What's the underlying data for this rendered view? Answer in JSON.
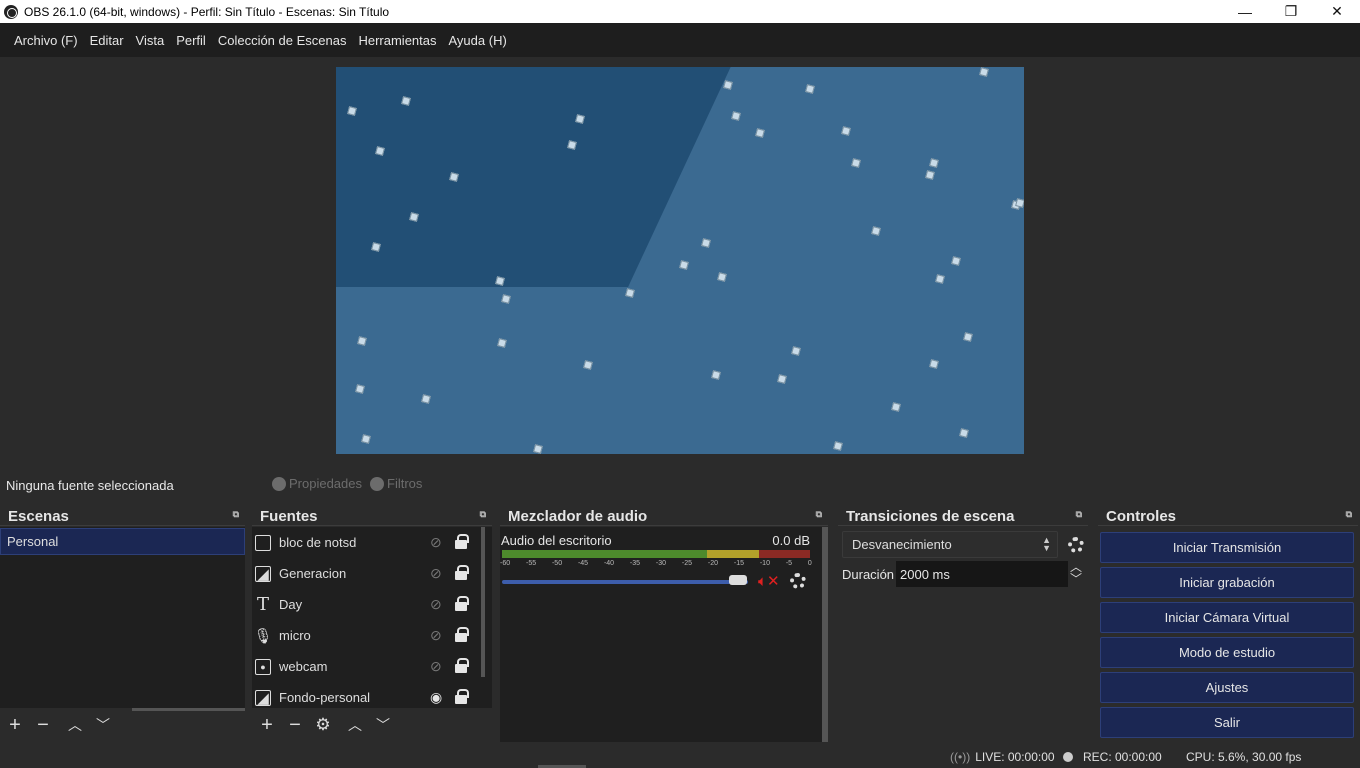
{
  "window": {
    "title": "OBS 26.1.0 (64-bit, windows) - Perfil: Sin Título - Escenas: Sin Título",
    "controls": [
      "minimize-icon",
      "restore-icon",
      "close-icon"
    ]
  },
  "menu": [
    "Archivo (F)",
    "Editar",
    "Vista",
    "Perfil",
    "Colección de Escenas",
    "Herramientas",
    "Ayuda (H)"
  ],
  "source_toolbar": {
    "no_selection": "Ninguna fuente seleccionada",
    "properties": "Propiedades",
    "filters": "Filtros"
  },
  "scenes": {
    "title": "Escenas",
    "items": [
      "Personal"
    ]
  },
  "sources": {
    "title": "Fuentes",
    "items": [
      {
        "name": "bloc de notsd",
        "icon": "window-capture-icon",
        "visible": false
      },
      {
        "name": "Generacion",
        "icon": "image-icon",
        "visible": false
      },
      {
        "name": "Day",
        "icon": "text-icon",
        "visible": false
      },
      {
        "name": "micro",
        "icon": "microphone-icon",
        "visible": false
      },
      {
        "name": "webcam",
        "icon": "camera-icon",
        "visible": false
      },
      {
        "name": "Fondo-personal",
        "icon": "image-icon",
        "visible": true
      }
    ]
  },
  "mixer": {
    "title": "Mezclador de audio",
    "channel": "Audio del escritorio",
    "level": "0.0 dB",
    "scale": [
      "-60",
      "-55",
      "-50",
      "-45",
      "-40",
      "-35",
      "-30",
      "-25",
      "-20",
      "-15",
      "-10",
      "-5",
      "0"
    ],
    "volume_fraction": 0.94,
    "muted": true
  },
  "transitions": {
    "title": "Transiciones de escena",
    "selected": "Desvanecimiento",
    "duration_label": "Duración",
    "duration_value": "2000 ms"
  },
  "controls": {
    "title": "Controles",
    "buttons": [
      "Iniciar Transmisión",
      "Iniciar grabación",
      "Iniciar Cámara Virtual",
      "Modo de estudio",
      "Ajustes",
      "Salir"
    ]
  },
  "status": {
    "live": "LIVE: 00:00:00",
    "rec": "REC: 00:00:00",
    "cpu": "CPU: 5.6%, 30.00 fps"
  },
  "colors": {
    "accent_button": "#1b2753",
    "preview_bg": "#3b6a91",
    "mute_red": "#e02020"
  }
}
